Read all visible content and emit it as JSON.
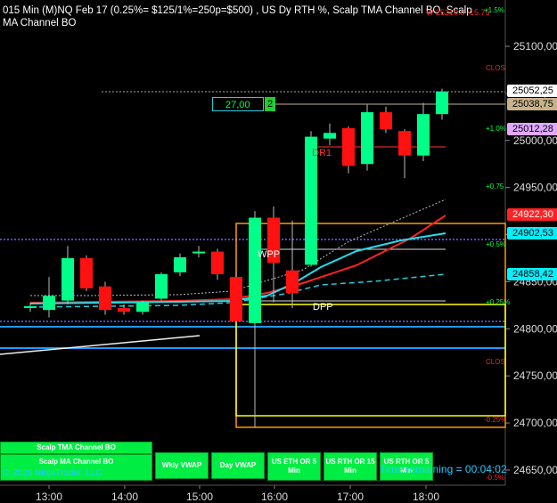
{
  "header": {
    "title": "015 Min (M)NQ Feb 17  (0.25%= $125/1%=250p=$500) , US Dy RTH %, Scalp TMA Channel BO, Scalp MA Channel BO",
    "overlay_text": "W 25210.0 -15.75"
  },
  "x_axis": {
    "ticks": [
      "13:00",
      "14:00",
      "15:00",
      "16:00",
      "17:00",
      "18:00"
    ]
  },
  "y_axis": {
    "ticks": [
      "25100,00",
      "25050,00",
      "25000,00",
      "24950,00",
      "24900,00",
      "24850,00",
      "24800,00",
      "24750,00",
      "24700,00",
      "24650,00"
    ]
  },
  "price_tags": [
    {
      "label": "25052,25",
      "color": "#ffffff"
    },
    {
      "label": "25038,75",
      "color": "#c8b28a"
    },
    {
      "label": "25012,28",
      "color": "#e0a8ff"
    },
    {
      "label": "24922,30",
      "color": "#ff2222"
    },
    {
      "label": "24902,53",
      "color": "#00f0ff"
    },
    {
      "label": "24858,42",
      "color": "#00f0ff"
    }
  ],
  "percent_labels": {
    "p15": "+1.5%",
    "p10": "+1.0%",
    "p075": "+0.75",
    "p05": "+0.5%",
    "p025": "+0.25%",
    "m025": "-0.25%",
    "m05": "-0.5%",
    "clos1": "CLOS",
    "clos2": "CLOS"
  },
  "chart_labels": {
    "dr1": "DR1",
    "wpp": "WPP",
    "dpp": "DPP"
  },
  "order": {
    "price": "27,00",
    "qty": "2"
  },
  "buttons": {
    "scalp_tma": "Scalp TMA Channel BO",
    "scalp_ma": "Scalp MA Channel BO",
    "wkly_vwap": "Wkly VWAP",
    "day_vwap": "Day VWAP",
    "eth_or": "US ETH OR 5 Min",
    "rth_or15": "US RTH OR 15 Min",
    "rth_or5": "US RTH OR 5 Min"
  },
  "footer": {
    "copyright": "© 2026 NinjaTrader, LLC",
    "time_remaining": "Time remaining = 00:04:02"
  },
  "chart_data": {
    "type": "candlestick",
    "title": "015 Min (M)NQ Feb 17",
    "ylim": [
      24640,
      25135
    ],
    "candles": [
      {
        "o": 24822,
        "h": 24828,
        "l": 24818,
        "c": 24824
      },
      {
        "o": 24820,
        "h": 24855,
        "l": 24812,
        "c": 24835
      },
      {
        "o": 24830,
        "h": 24888,
        "l": 24826,
        "c": 24875
      },
      {
        "o": 24875,
        "h": 24878,
        "l": 24840,
        "c": 24843
      },
      {
        "o": 24845,
        "h": 24850,
        "l": 24815,
        "c": 24820
      },
      {
        "o": 24822,
        "h": 24826,
        "l": 24815,
        "c": 24818
      },
      {
        "o": 24818,
        "h": 24830,
        "l": 24815,
        "c": 24828
      },
      {
        "o": 24832,
        "h": 24860,
        "l": 24830,
        "c": 24858
      },
      {
        "o": 24860,
        "h": 24880,
        "l": 24856,
        "c": 24876
      },
      {
        "o": 24882,
        "h": 24888,
        "l": 24876,
        "c": 24882
      },
      {
        "o": 24882,
        "h": 24885,
        "l": 24852,
        "c": 24858
      },
      {
        "o": 24855,
        "h": 24860,
        "l": 24806,
        "c": 24808
      },
      {
        "o": 24806,
        "h": 24925,
        "l": 24695,
        "c": 24918
      },
      {
        "o": 24918,
        "h": 24930,
        "l": 24828,
        "c": 24870
      },
      {
        "o": 24862,
        "h": 24915,
        "l": 24822,
        "c": 24838
      },
      {
        "o": 24868,
        "h": 25010,
        "l": 24866,
        "c": 25004
      },
      {
        "o": 25002,
        "h": 25018,
        "l": 24995,
        "c": 25008
      },
      {
        "o": 25013,
        "h": 25015,
        "l": 24965,
        "c": 24973
      },
      {
        "o": 24975,
        "h": 25038,
        "l": 24968,
        "c": 25030
      },
      {
        "o": 25030,
        "h": 25036,
        "l": 25008,
        "c": 25012
      },
      {
        "o": 25010,
        "h": 25012,
        "l": 24960,
        "c": 24984
      },
      {
        "o": 24984,
        "h": 25040,
        "l": 24978,
        "c": 25028
      },
      {
        "o": 25028,
        "h": 25055,
        "l": 25022,
        "c": 25052
      }
    ]
  },
  "colors": {
    "up": "#00ff88",
    "down": "#ff1111",
    "bg": "#000000",
    "orange": "#ff9900",
    "yellow": "#ffff00",
    "blue": "#2299ff",
    "violet": "#6666ff"
  }
}
